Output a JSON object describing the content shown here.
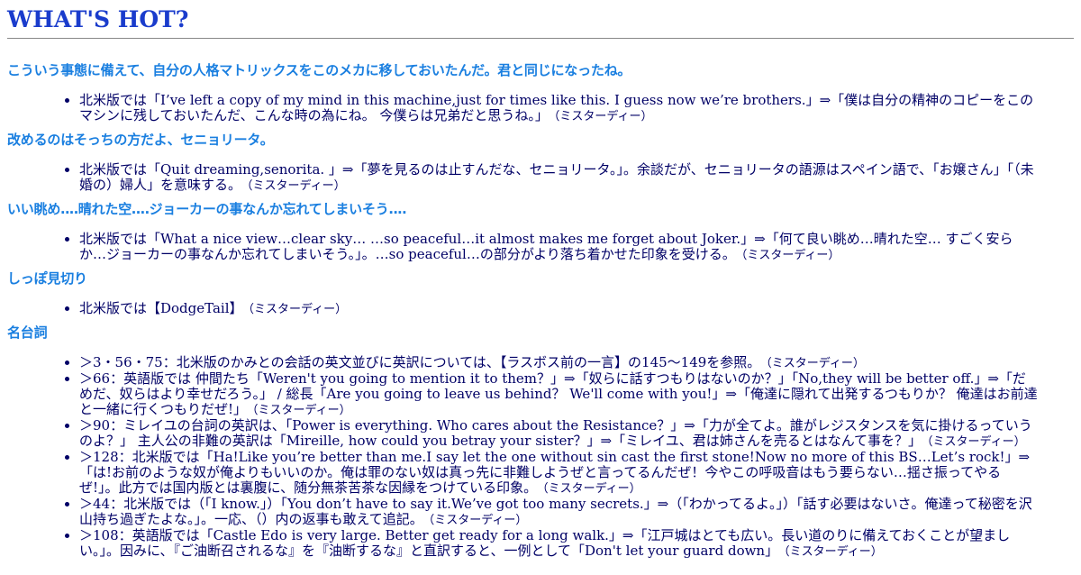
{
  "page_title": "WHAT'S HOT?",
  "attribution": "（ミスターディー）",
  "sections": [
    {
      "heading": "こういう事態に備えて、自分の人格マトリックスをこのメカに移しておいたんだ。君と同じになったね。",
      "items": [
        "北米版では「I’ve left a copy of my mind in this machine,just for times like this. I guess now we’re brothers.」⇒「僕は自分の精神のコピーをこのマシンに残しておいたんだ、こんな時の為にね。 今僕らは兄弟だと思うね。」"
      ]
    },
    {
      "heading": "改めるのはそっちの方だよ、セニョリータ。",
      "items": [
        "北米版では「Quit dreaming,senorita. 」⇒「夢を見るのは止すんだな、セニョリータ。」。余談だが、セニョリータの語源はスペイン語で、「お嬢さん」「（未婚の）婦人」を意味する。"
      ]
    },
    {
      "heading": "いい眺め‥‥晴れた空‥‥ジョーカーの事なんか忘れてしまいそう‥‥",
      "items": [
        "北米版では「What a nice view…clear sky… …so peaceful…it almost makes me forget about Joker.」⇒「何て良い眺め…晴れた空… すごく安らか…ジョーカーの事なんか忘れてしまいそう。」。…so peaceful…の部分がより落ち着かせた印象を受ける。"
      ]
    },
    {
      "heading": "しっぽ見切り",
      "items": [
        "北米版では【DodgeTail】"
      ]
    },
    {
      "heading": "名台詞",
      "items": [
        "＞3・56・75：北米版のかみとの会話の英文並びに英訳については、【ラスボス前の一言】の145～149を参照。",
        "＞66：英語版では 仲間たち「Weren't you going to mention it to them？」⇒「奴らに話すつもりはないのか？」「No,they will be better off.」⇒「だめだ、奴らはより幸せだろう。」 / 総長「Are you going to leave us behind？ We'll come with you!」⇒「俺達に隠れて出発するつもりか？ 俺達はお前達と一緒に行くつもりだぜ!」",
        "＞90：ミレイユの台詞の英訳は、「Power is everything. Who cares about the Resistance？」⇒「力が全てよ。誰がレジスタンスを気に掛けるっていうのよ？」 主人公の非難の英訳は「Mireille, how could you betray your sister？」⇒「ミレイユ、君は姉さんを売るとはなんて事を？」",
        "＞128：北米版では「Ha!Like you’re better than me.I say let the one without sin cast the first stone!Now no more of this BS…Let’s rock!」⇒「は!お前のような奴が俺よりもいいのか。俺は罪のない奴は真っ先に非難しようぜと言ってるんだぜ！今やこの呼吸音はもう要らない…揺さ振ってやるぜ!」。此方では国内版とは裏腹に、随分無茶苦茶な因縁をつけている印象。",
        "＞44：北米版では（「I know.」）「You don’t have to say it.We’ve got too many secrets.」⇒（「わかってるよ。」）「話す必要はないさ。俺達って秘密を沢山持ち過ぎたよな。」。一応、（）内の返事も敢えて追記。",
        "＞108：英語版では「Castle Edo is very large. Better get ready for a long walk.」⇒「江戸城はとても広い。長い道のりに備えておくことが望ましい。」。因みに、『ご油断召されるな』を『油断するな』と直訳すると、一例として「Don't let your guard down」"
      ]
    }
  ]
}
